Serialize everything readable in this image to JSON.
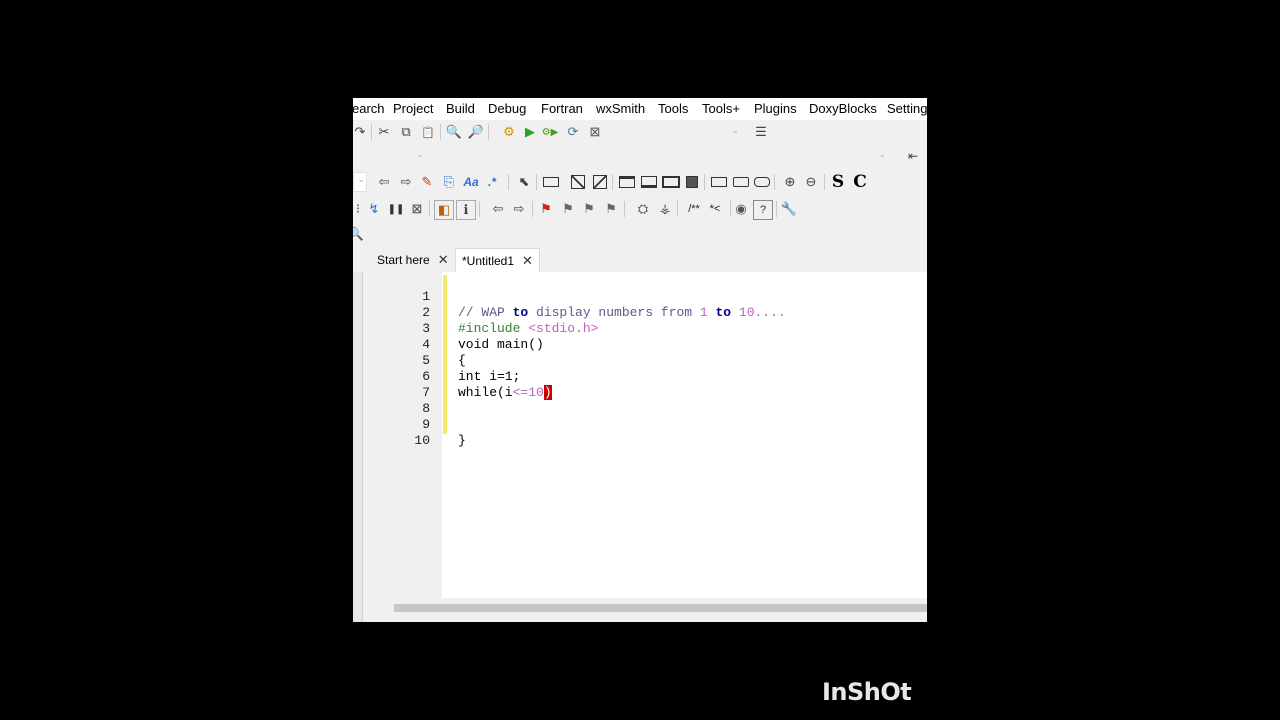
{
  "menu": [
    "earch",
    "Project",
    "Build",
    "Debug",
    "Fortran",
    "wxSmith",
    "Tools",
    "Tools+",
    "Plugins",
    "DoxyBlocks",
    "Settings"
  ],
  "toolbar": {
    "redo": "↷",
    "cut": "✂",
    "copy": "⧉",
    "paste": "📋",
    "find": "🔍",
    "replace": "🔎",
    "build": "⚙",
    "run": "▶",
    "build_run": "⚙▶",
    "rebuild": "⟳",
    "abort": "⊠",
    "log": "☰"
  },
  "search_toolbar": {
    "back": "⇦",
    "forward": "⇨",
    "highlight": "✎",
    "selected_text": "⎘",
    "match_case": "Aa",
    "regex": ".*",
    "select": "⬉",
    "zoom_in": "⊕",
    "zoom_out": "⊖",
    "s_label": "S",
    "c_label": "C"
  },
  "debug_toolbar": {
    "doxy_comment": "/**",
    "doxy_line": "*<",
    "help": "?",
    "settings": "🔧"
  },
  "tabs": [
    {
      "label": "Start here",
      "close": "✕"
    },
    {
      "label": "*Untitled1",
      "close": "✕"
    }
  ],
  "code": {
    "line_numbers": [
      "1",
      "2",
      "3",
      "4",
      "5",
      "6",
      "7",
      "8",
      "9",
      "10"
    ],
    "l1_prefix": "// WAP ",
    "l1_kw1": "to",
    "l1_mid": " display numbers from ",
    "l1_num1": "1",
    "l1_sp": " ",
    "l1_kw2": "to",
    "l1_sp2": " ",
    "l1_num2": "10....",
    "l2_pp": "#include ",
    "l2_hdr": "<stdio.h>",
    "l3": "void main()",
    "l4": "{",
    "l5": "int i=1;",
    "l6_text": "while(i",
    "l6_op": "<=10",
    "l6_paren": ")",
    "l9": "}"
  },
  "watermark": "InShOt"
}
